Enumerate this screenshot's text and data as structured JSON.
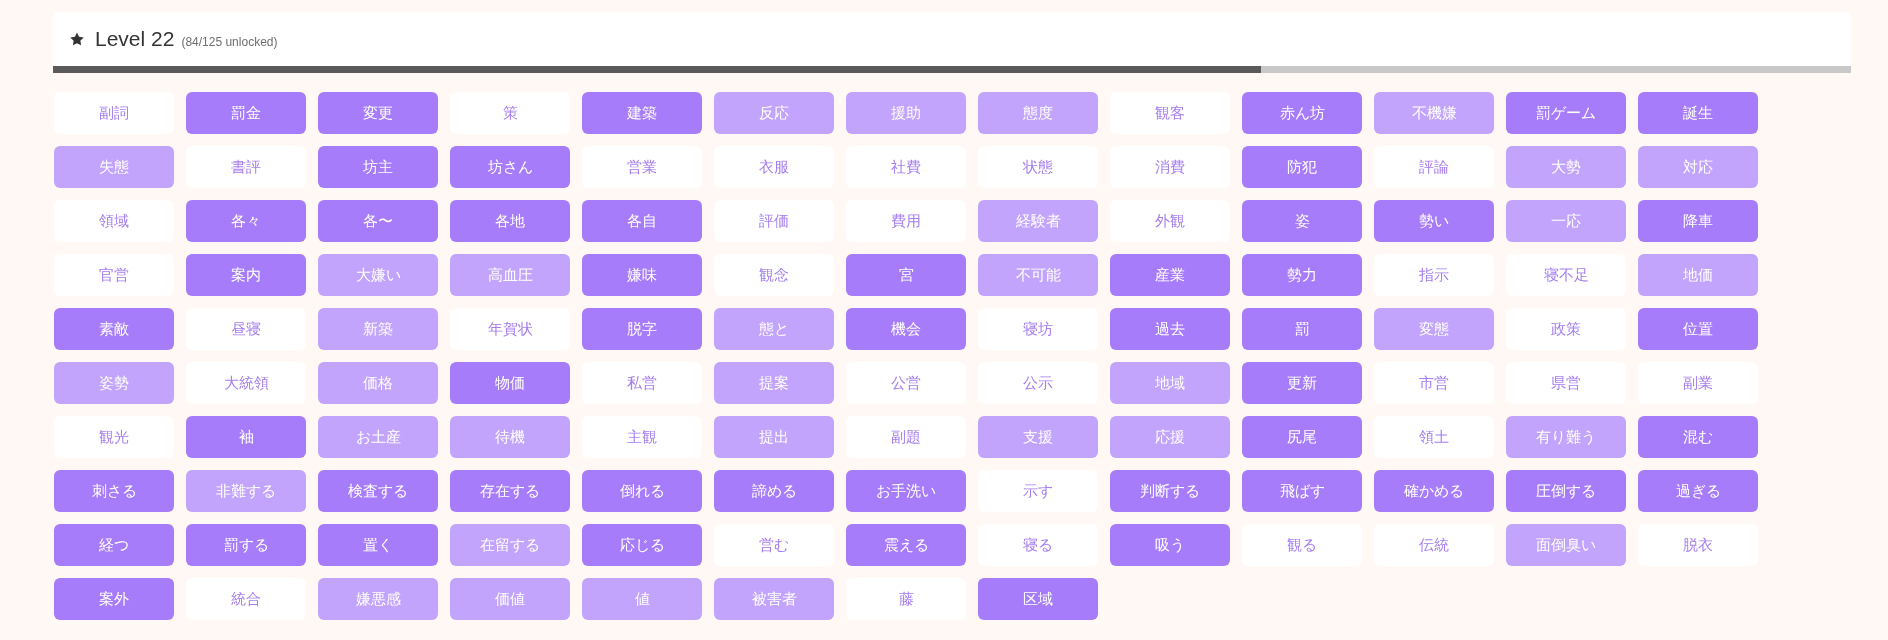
{
  "header": {
    "title": "Level 22",
    "subtitle": "(84/125 unlocked)",
    "progress": {
      "level": 0.672
    }
  },
  "words": [
    {
      "text": "副詞",
      "kind": "locked"
    },
    {
      "text": "罰金",
      "kind": "mastered"
    },
    {
      "text": "変更",
      "kind": "mastered"
    },
    {
      "text": "策",
      "kind": "locked"
    },
    {
      "text": "建築",
      "kind": "mastered"
    },
    {
      "text": "反応",
      "kind": "unlocked"
    },
    {
      "text": "援助",
      "kind": "unlocked"
    },
    {
      "text": "態度",
      "kind": "unlocked"
    },
    {
      "text": "観客",
      "kind": "locked"
    },
    {
      "text": "赤ん坊",
      "kind": "mastered"
    },
    {
      "text": "不機嫌",
      "kind": "unlocked"
    },
    {
      "text": "罰ゲーム",
      "kind": "mastered"
    },
    {
      "text": "誕生",
      "kind": "mastered"
    },
    {
      "text": "失態",
      "kind": "unlocked"
    },
    {
      "text": "書評",
      "kind": "locked"
    },
    {
      "text": "坊主",
      "kind": "mastered"
    },
    {
      "text": "坊さん",
      "kind": "mastered"
    },
    {
      "text": "営業",
      "kind": "locked"
    },
    {
      "text": "衣服",
      "kind": "locked"
    },
    {
      "text": "社費",
      "kind": "locked"
    },
    {
      "text": "状態",
      "kind": "locked"
    },
    {
      "text": "消費",
      "kind": "locked"
    },
    {
      "text": "防犯",
      "kind": "mastered"
    },
    {
      "text": "評論",
      "kind": "locked"
    },
    {
      "text": "大勢",
      "kind": "unlocked"
    },
    {
      "text": "対応",
      "kind": "unlocked"
    },
    {
      "text": "領域",
      "kind": "locked"
    },
    {
      "text": "各々",
      "kind": "mastered"
    },
    {
      "text": "各〜",
      "kind": "mastered"
    },
    {
      "text": "各地",
      "kind": "mastered"
    },
    {
      "text": "各自",
      "kind": "mastered"
    },
    {
      "text": "評価",
      "kind": "locked"
    },
    {
      "text": "費用",
      "kind": "locked"
    },
    {
      "text": "経験者",
      "kind": "unlocked"
    },
    {
      "text": "外観",
      "kind": "locked"
    },
    {
      "text": "姿",
      "kind": "mastered"
    },
    {
      "text": "勢い",
      "kind": "mastered"
    },
    {
      "text": "一応",
      "kind": "unlocked"
    },
    {
      "text": "降車",
      "kind": "mastered"
    },
    {
      "text": "官営",
      "kind": "locked"
    },
    {
      "text": "案内",
      "kind": "mastered"
    },
    {
      "text": "大嫌い",
      "kind": "unlocked"
    },
    {
      "text": "高血圧",
      "kind": "unlocked"
    },
    {
      "text": "嫌味",
      "kind": "mastered"
    },
    {
      "text": "観念",
      "kind": "locked"
    },
    {
      "text": "宮",
      "kind": "mastered"
    },
    {
      "text": "不可能",
      "kind": "unlocked"
    },
    {
      "text": "産業",
      "kind": "mastered"
    },
    {
      "text": "勢力",
      "kind": "mastered"
    },
    {
      "text": "指示",
      "kind": "locked"
    },
    {
      "text": "寝不足",
      "kind": "locked"
    },
    {
      "text": "地価",
      "kind": "unlocked"
    },
    {
      "text": "素敵",
      "kind": "mastered"
    },
    {
      "text": "昼寝",
      "kind": "locked"
    },
    {
      "text": "新築",
      "kind": "unlocked"
    },
    {
      "text": "年賀状",
      "kind": "locked"
    },
    {
      "text": "脱字",
      "kind": "mastered"
    },
    {
      "text": "態と",
      "kind": "unlocked"
    },
    {
      "text": "機会",
      "kind": "mastered"
    },
    {
      "text": "寝坊",
      "kind": "locked"
    },
    {
      "text": "過去",
      "kind": "mastered"
    },
    {
      "text": "罰",
      "kind": "mastered"
    },
    {
      "text": "変態",
      "kind": "unlocked"
    },
    {
      "text": "政策",
      "kind": "locked"
    },
    {
      "text": "位置",
      "kind": "mastered"
    },
    {
      "text": "姿勢",
      "kind": "unlocked"
    },
    {
      "text": "大統領",
      "kind": "locked"
    },
    {
      "text": "価格",
      "kind": "unlocked"
    },
    {
      "text": "物価",
      "kind": "mastered"
    },
    {
      "text": "私営",
      "kind": "locked"
    },
    {
      "text": "提案",
      "kind": "unlocked"
    },
    {
      "text": "公営",
      "kind": "locked"
    },
    {
      "text": "公示",
      "kind": "locked"
    },
    {
      "text": "地域",
      "kind": "unlocked"
    },
    {
      "text": "更新",
      "kind": "mastered"
    },
    {
      "text": "市営",
      "kind": "locked"
    },
    {
      "text": "県営",
      "kind": "locked"
    },
    {
      "text": "副業",
      "kind": "locked"
    },
    {
      "text": "観光",
      "kind": "locked"
    },
    {
      "text": "袖",
      "kind": "mastered"
    },
    {
      "text": "お土産",
      "kind": "unlocked"
    },
    {
      "text": "待機",
      "kind": "unlocked"
    },
    {
      "text": "主観",
      "kind": "locked"
    },
    {
      "text": "提出",
      "kind": "unlocked"
    },
    {
      "text": "副題",
      "kind": "locked"
    },
    {
      "text": "支援",
      "kind": "unlocked"
    },
    {
      "text": "応援",
      "kind": "unlocked"
    },
    {
      "text": "尻尾",
      "kind": "mastered"
    },
    {
      "text": "領土",
      "kind": "locked"
    },
    {
      "text": "有り難う",
      "kind": "unlocked"
    },
    {
      "text": "混む",
      "kind": "mastered"
    },
    {
      "text": "刺さる",
      "kind": "mastered"
    },
    {
      "text": "非難する",
      "kind": "unlocked"
    },
    {
      "text": "検査する",
      "kind": "mastered"
    },
    {
      "text": "存在する",
      "kind": "mastered"
    },
    {
      "text": "倒れる",
      "kind": "mastered"
    },
    {
      "text": "諦める",
      "kind": "mastered"
    },
    {
      "text": "お手洗い",
      "kind": "mastered"
    },
    {
      "text": "示す",
      "kind": "locked"
    },
    {
      "text": "判断する",
      "kind": "mastered"
    },
    {
      "text": "飛ばす",
      "kind": "mastered"
    },
    {
      "text": "確かめる",
      "kind": "mastered"
    },
    {
      "text": "圧倒する",
      "kind": "mastered"
    },
    {
      "text": "過ぎる",
      "kind": "mastered"
    },
    {
      "text": "経つ",
      "kind": "mastered"
    },
    {
      "text": "罰する",
      "kind": "mastered"
    },
    {
      "text": "置く",
      "kind": "mastered"
    },
    {
      "text": "在留する",
      "kind": "unlocked"
    },
    {
      "text": "応じる",
      "kind": "mastered"
    },
    {
      "text": "営む",
      "kind": "locked"
    },
    {
      "text": "震える",
      "kind": "mastered"
    },
    {
      "text": "寝る",
      "kind": "locked"
    },
    {
      "text": "吸う",
      "kind": "mastered"
    },
    {
      "text": "観る",
      "kind": "locked"
    },
    {
      "text": "伝統",
      "kind": "locked"
    },
    {
      "text": "面倒臭い",
      "kind": "unlocked"
    },
    {
      "text": "脱衣",
      "kind": "locked"
    },
    {
      "text": "案外",
      "kind": "mastered"
    },
    {
      "text": "統合",
      "kind": "locked"
    },
    {
      "text": "嫌悪感",
      "kind": "unlocked"
    },
    {
      "text": "価値",
      "kind": "unlocked"
    },
    {
      "text": "値",
      "kind": "unlocked"
    },
    {
      "text": "被害者",
      "kind": "unlocked"
    },
    {
      "text": "藤",
      "kind": "locked"
    },
    {
      "text": "区域",
      "kind": "mastered"
    }
  ]
}
